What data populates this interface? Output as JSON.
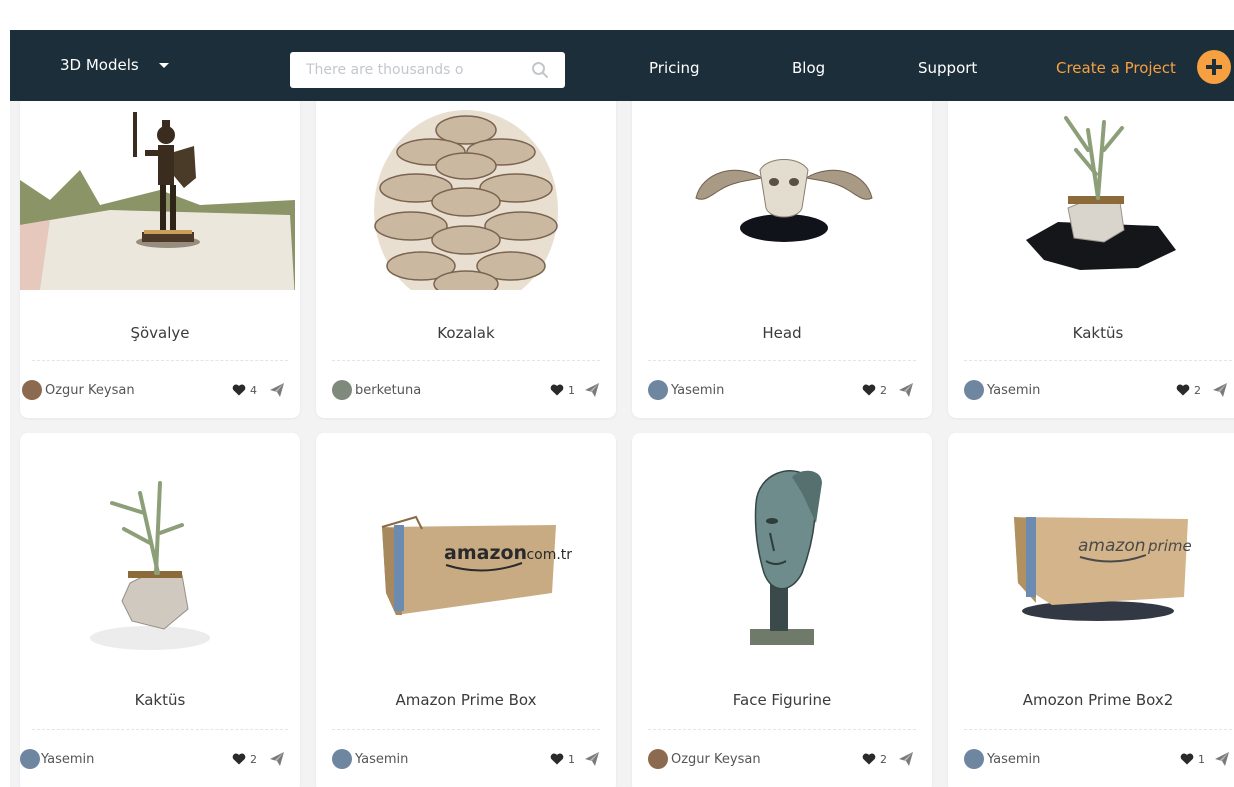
{
  "nav": {
    "models_label": "3D Models",
    "search_placeholder": "There are thousands o",
    "pricing": "Pricing",
    "blog": "Blog",
    "support": "Support",
    "create_project": "Create a Project"
  },
  "colors": {
    "navbar": "#1b2e3a",
    "accent": "#f7a041",
    "background": "#f3f3f4"
  },
  "icons": {
    "search": "search-icon",
    "dropdown": "caret-down-icon",
    "create": "plus-icon",
    "like": "heart-icon",
    "share": "send-icon"
  },
  "models": [
    {
      "title": "Şövalye",
      "author": "Ozgur Keysan",
      "likes": "4"
    },
    {
      "title": "Kozalak",
      "author": "berketuna",
      "likes": "1"
    },
    {
      "title": "Head",
      "author": "Yasemin",
      "likes": "2"
    },
    {
      "title": "Kaktüs",
      "author": "Yasemin",
      "likes": "2"
    },
    {
      "title": "Kaktüs",
      "author": "Yasemin",
      "likes": "2"
    },
    {
      "title": "Amazon Prime Box",
      "author": "Yasemin",
      "likes": "1"
    },
    {
      "title": "Face Figurine",
      "author": "Ozgur Keysan",
      "likes": "2"
    },
    {
      "title": "Amozon Prime Box2",
      "author": "Yasemin",
      "likes": "1"
    }
  ]
}
